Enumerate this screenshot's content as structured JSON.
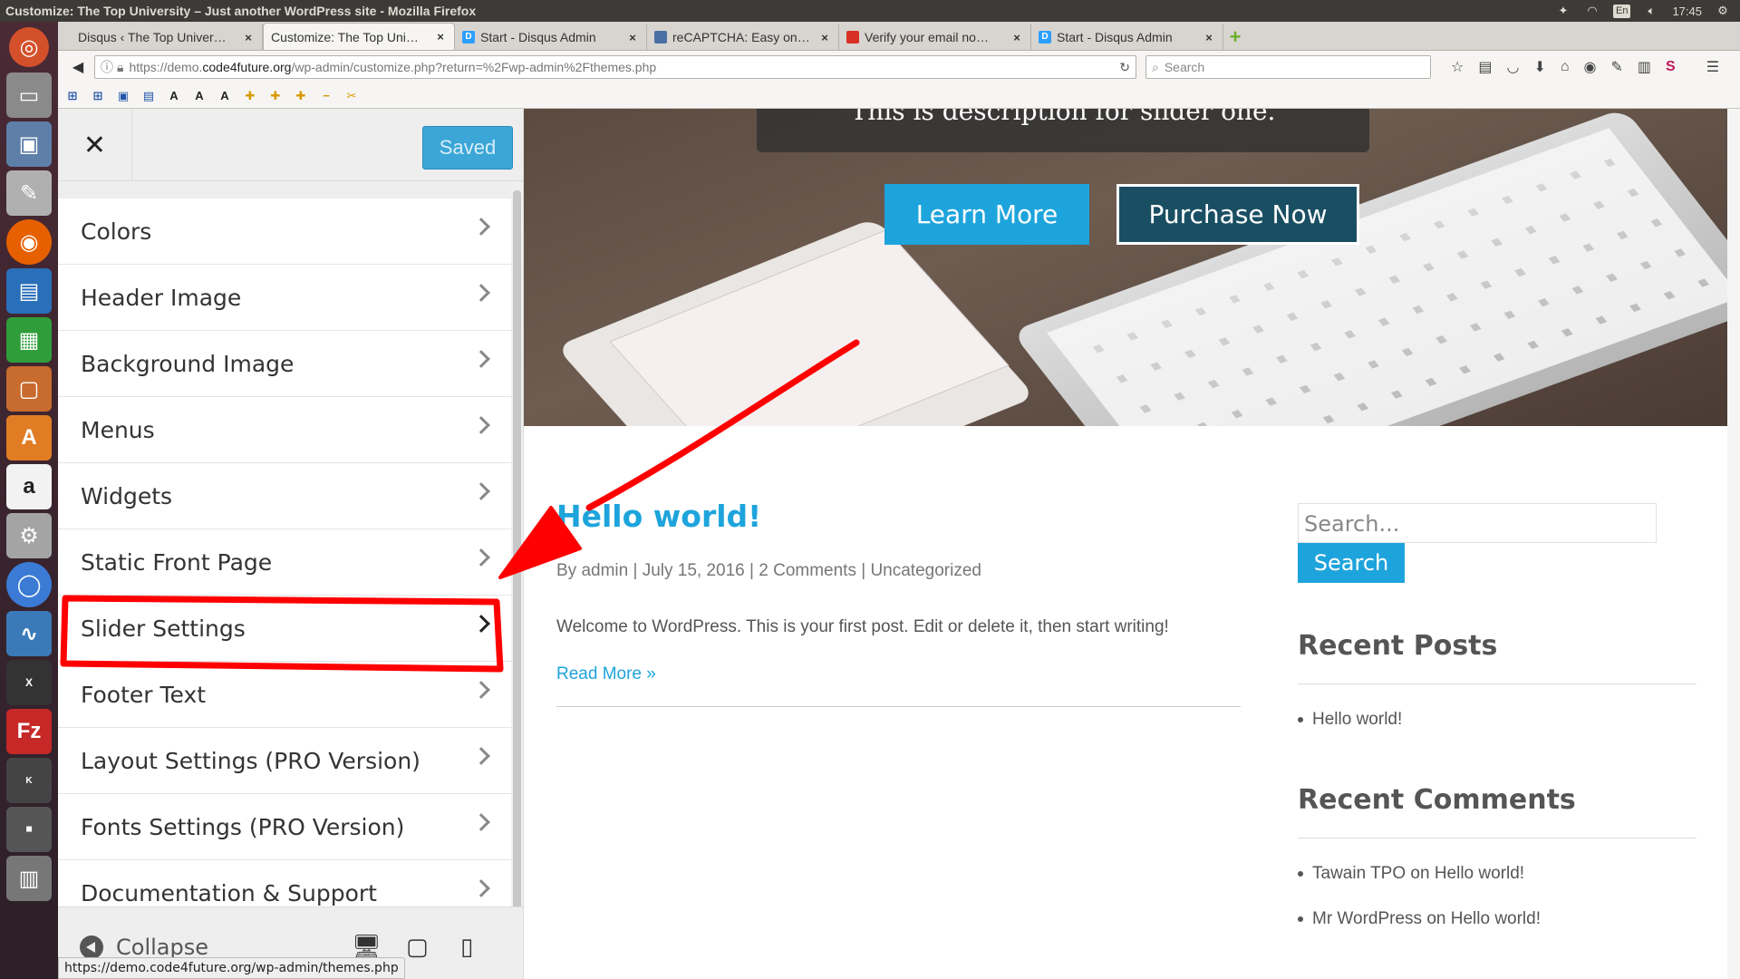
{
  "os": {
    "window_title": "Customize: The Top University – Just another WordPress site - Mozilla Firefox",
    "lang": "En",
    "clock": "17:45"
  },
  "browser": {
    "tabs": [
      {
        "label": "Disqus ‹ The Top Univer…",
        "fav_color": "#ffffff",
        "fav": ""
      },
      {
        "label": "Customize: The Top Uni…",
        "fav_color": "#ffffff",
        "fav": ""
      },
      {
        "label": "Start - Disqus Admin",
        "fav_color": "#2e9fff",
        "fav": "D"
      },
      {
        "label": "reCAPTCHA: Easy on…",
        "fav_color": "#4a6fa5",
        "fav": ""
      },
      {
        "label": "Verify your email no…",
        "fav_color": "#d93025",
        "fav": ""
      },
      {
        "label": "Start - Disqus Admin",
        "fav_color": "#2e9fff",
        "fav": "D"
      }
    ],
    "url_prefix": "https://demo.",
    "url_host": "code4future.org",
    "url_path": "/wp-admin/customize.php?return=%2Fwp-admin%2Fthemes.php",
    "search_placeholder": "Search",
    "status_url": "https://demo.code4future.org/wp-admin/themes.php"
  },
  "customizer": {
    "saved_label": "Saved",
    "close_label": "✕",
    "items": [
      {
        "label": "Colors"
      },
      {
        "label": "Header Image"
      },
      {
        "label": "Background Image"
      },
      {
        "label": "Menus"
      },
      {
        "label": "Widgets"
      },
      {
        "label": "Static Front Page"
      },
      {
        "label": "Slider Settings"
      },
      {
        "label": "Footer Text"
      },
      {
        "label": "Layout Settings (PRO Version)"
      },
      {
        "label": "Fonts Settings (PRO Version)"
      },
      {
        "label": "Documentation & Support"
      }
    ],
    "collapse_label": "Collapse"
  },
  "preview": {
    "slider_description": "This is description for slider one.",
    "learn_more": "Learn More",
    "purchase_now": "Purchase Now",
    "post": {
      "title": "Hello world!",
      "meta_by": "By",
      "author": "admin",
      "date": "July 15, 2016",
      "comments": "2 Comments",
      "category": "Uncategorized",
      "body": "Welcome to WordPress. This is your first post. Edit or delete it, then start writing!",
      "read_more": "Read More »"
    },
    "widgets": {
      "search_placeholder": "Search...",
      "search_button": "Search",
      "recent_posts_title": "Recent Posts",
      "recent_posts": [
        "Hello world!"
      ],
      "recent_comments_title": "Recent Comments",
      "recent_comments": [
        "Tawain TPO on Hello world!",
        "Mr WordPress on Hello world!"
      ]
    }
  },
  "colors": {
    "accent": "#1ea4dc",
    "annotation": "#ff0000"
  }
}
